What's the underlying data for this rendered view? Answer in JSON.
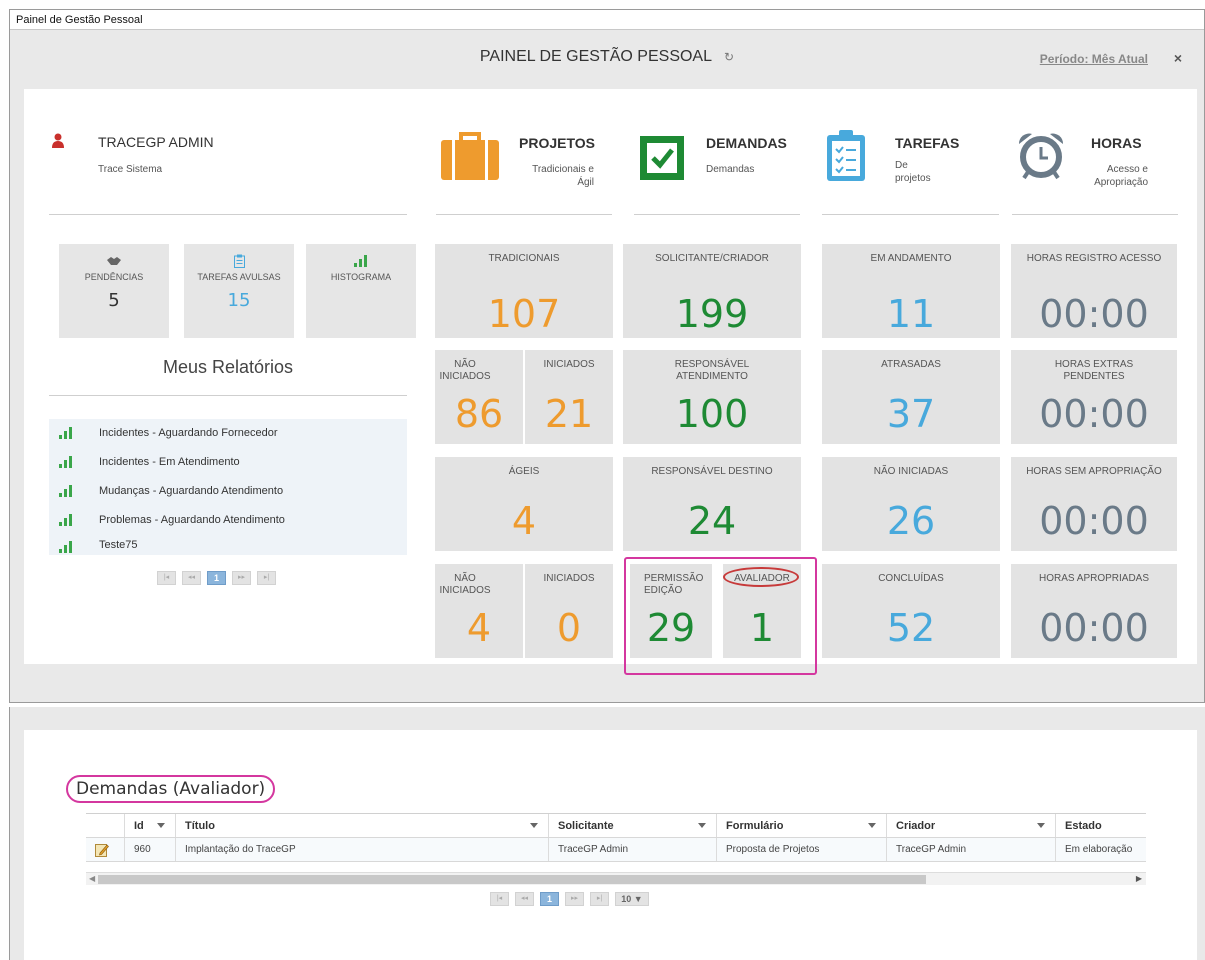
{
  "window": {
    "title": "Painel de Gestão Pessoal"
  },
  "header": {
    "title": "PAINEL DE GESTÃO PESSOAL",
    "refresh_glyph": "↻",
    "period": "Período: Mês Atual",
    "close": "×"
  },
  "user": {
    "name": "TRACEGP ADMIN",
    "subtitle": "Trace Sistema"
  },
  "categories": {
    "projetos": {
      "title": "PROJETOS",
      "subtitle": "Tradicionais e Ágil",
      "color": "#ee9b2e"
    },
    "demandas": {
      "title": "DEMANDAS",
      "subtitle": "Demandas",
      "color": "#1e8a34"
    },
    "tarefas": {
      "title": "TAREFAS",
      "subtitle": "De projetos",
      "color": "#48a9dc"
    },
    "horas": {
      "title": "HORAS",
      "subtitle": "Acesso e Apropriação",
      "color": "#6a7a88"
    }
  },
  "shortcuts": [
    {
      "label": "PENDÊNCIAS",
      "value": "5",
      "icon": "handshake-icon"
    },
    {
      "label": "TAREFAS AVULSAS",
      "value": "15",
      "icon": "clipboard-icon"
    },
    {
      "label": "HISTOGRAMA",
      "value": "",
      "icon": "bar-chart-icon"
    }
  ],
  "reports": {
    "title": "Meus Relatórios",
    "items": [
      "Incidentes - Aguardando Fornecedor",
      "Incidentes - Em Atendimento",
      "Mudanças - Aguardando Atendimento",
      "Problemas - Aguardando Atendimento",
      "Teste75"
    ],
    "page": "1"
  },
  "pager": {
    "first": "|◂",
    "prev": "◂◂",
    "next": "▸▸",
    "last": "▸|"
  },
  "projetos_tiles": {
    "tradicionais": {
      "label": "TRADICIONAIS",
      "value": "107"
    },
    "trad_nao_iniciados": {
      "label": "NÃO INICIADOS",
      "value": "86"
    },
    "trad_iniciados": {
      "label": "INICIADOS",
      "value": "21"
    },
    "ageis": {
      "label": "ÁGEIS",
      "value": "4"
    },
    "ageis_nao_iniciados": {
      "label": "NÃO INICIADOS",
      "value": "4"
    },
    "ageis_iniciados": {
      "label": "INICIADOS",
      "value": "0"
    }
  },
  "demandas_tiles": {
    "solicitante": {
      "label": "SOLICITANTE/CRIADOR",
      "value": "199"
    },
    "responsavel_atendimento": {
      "label": "RESPONSÁVEL ATENDIMENTO",
      "value": "100"
    },
    "responsavel_destino": {
      "label": "RESPONSÁVEL DESTINO",
      "value": "24"
    },
    "permissao_edicao": {
      "label": "PERMISSÃO EDIÇÃO",
      "value": "29"
    },
    "avaliador": {
      "label": "AVALIADOR",
      "value": "1"
    }
  },
  "tarefas_tiles": {
    "em_andamento": {
      "label": "EM ANDAMENTO",
      "value": "11"
    },
    "atrasadas": {
      "label": "ATRASADAS",
      "value": "37"
    },
    "nao_iniciadas": {
      "label": "NÃO INICIADAS",
      "value": "26"
    },
    "concluidas": {
      "label": "CONCLUÍDAS",
      "value": "52"
    }
  },
  "horas_tiles": {
    "registro_acesso": {
      "label": "HORAS REGISTRO ACESSO",
      "value": "00:00"
    },
    "extras_pendentes": {
      "label": "HORAS EXTRAS PENDENTES",
      "value": "00:00"
    },
    "sem_apropriacao": {
      "label": "HORAS SEM APROPRIAÇÃO",
      "value": "00:00"
    },
    "apropriadas": {
      "label": "HORAS APROPRIADAS",
      "value": "00:00"
    }
  },
  "demandas_grid": {
    "title": "Demandas (Avaliador)",
    "columns": [
      "Id",
      "Título",
      "Solicitante",
      "Formulário",
      "Criador",
      "Estado"
    ],
    "rows": [
      {
        "id": "960",
        "titulo": "Implantação do TraceGP",
        "solicitante": "TraceGP Admin",
        "formulario": "Proposta de Projetos",
        "criador": "TraceGP Admin",
        "estado": "Em elaboração"
      }
    ],
    "page": "1",
    "page_size": "10 ▼"
  }
}
